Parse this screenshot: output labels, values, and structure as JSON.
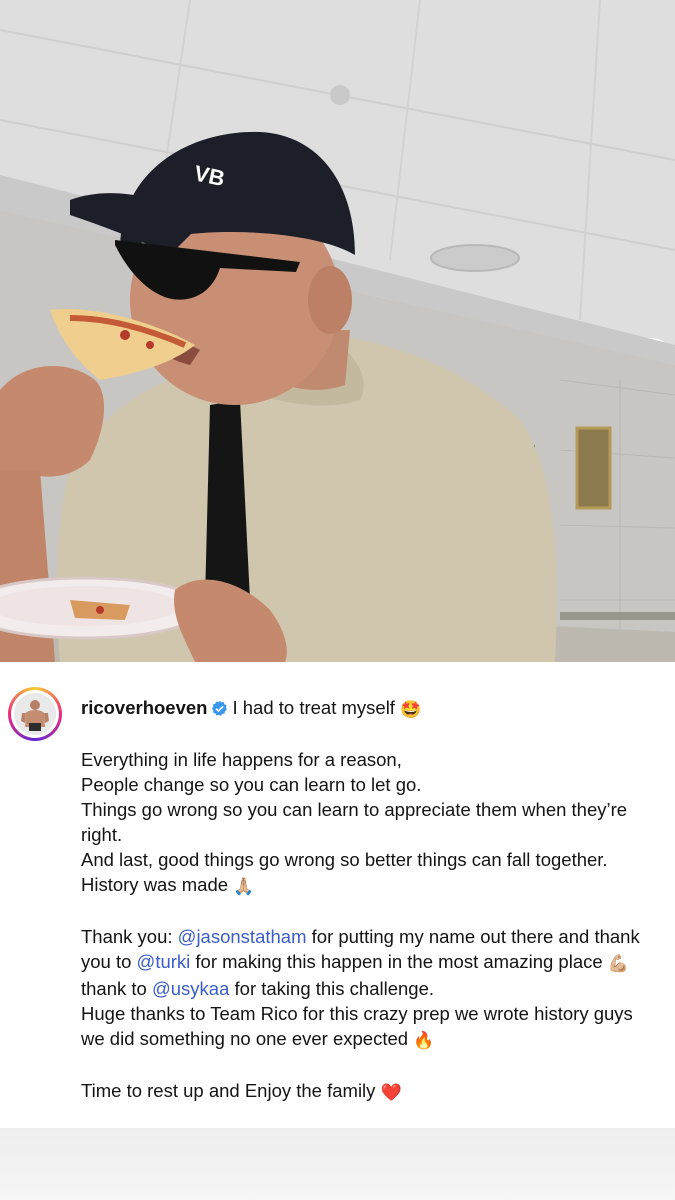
{
  "post": {
    "username": "ricoverhoeven",
    "first_line": "I had to treat myself",
    "first_line_emoji": "🤩",
    "paragraph1": [
      "Everything in life happens for a reason,",
      "People change so you can learn to let go.",
      "Things go wrong so you can learn to appreciate them when they’re right.",
      "And last, good things go wrong so better things can fall together."
    ],
    "history_line": "History was made",
    "history_emoji": "🙏🏼",
    "thanks": {
      "lead": "Thank you: ",
      "mention1": "@jasonstatham",
      "mid1": " for putting my name out there and thank you to ",
      "mention2": "@turki",
      "mid2": " for making this happen in the most amazing place ",
      "emoji_muscle": "💪🏼",
      "mid3": " thank to ",
      "mention3": "@usykaa",
      "tail": " for taking this challenge."
    },
    "team_line": "Huge thanks to Team Rico for this crazy prep we wrote history guys we did something no one ever expected",
    "team_emoji": "🔥",
    "closing_line": "Time to rest up and Enjoy the family",
    "closing_emoji": "❤️"
  },
  "photo": {
    "cap_text": "VB"
  },
  "colors": {
    "mention": "#3b5dc9",
    "verified": "#3897f0",
    "text": "#141414"
  },
  "icons": {
    "verified": "verified-badge-icon"
  }
}
